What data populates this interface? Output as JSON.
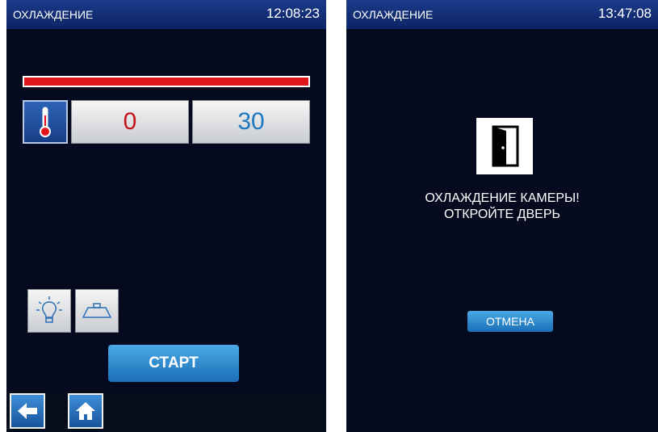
{
  "left_screen": {
    "header": {
      "title": "ОХЛАЖДЕНИЕ",
      "clock": "12:08:23"
    },
    "progress": {
      "fraction": 1.0,
      "color": "#e0161b"
    },
    "temperature": {
      "icon": "thermometer-icon",
      "current": "0",
      "target": "30",
      "current_color": "#c4121a",
      "target_color": "#1d78c0"
    },
    "tools": [
      {
        "icon": "lightbulb-icon"
      },
      {
        "icon": "tray-icon"
      }
    ],
    "start_label": "СТАРТ",
    "footer": {
      "back_icon": "back-arrow-icon",
      "home_icon": "home-icon"
    }
  },
  "right_screen": {
    "header": {
      "title": "ОХЛАЖДЕНИЕ",
      "clock": "13:47:08"
    },
    "door_icon": "door-open-icon",
    "message": {
      "line1": "ОХЛАЖДЕНИЕ КАМЕРЫ!",
      "line2": "ОТКРОЙТЕ ДВЕРЬ"
    },
    "cancel_label": "ОТМЕНА"
  },
  "colors": {
    "background": "#050a1e",
    "header": "#1a3a88",
    "accent": "#1b6fb6"
  }
}
